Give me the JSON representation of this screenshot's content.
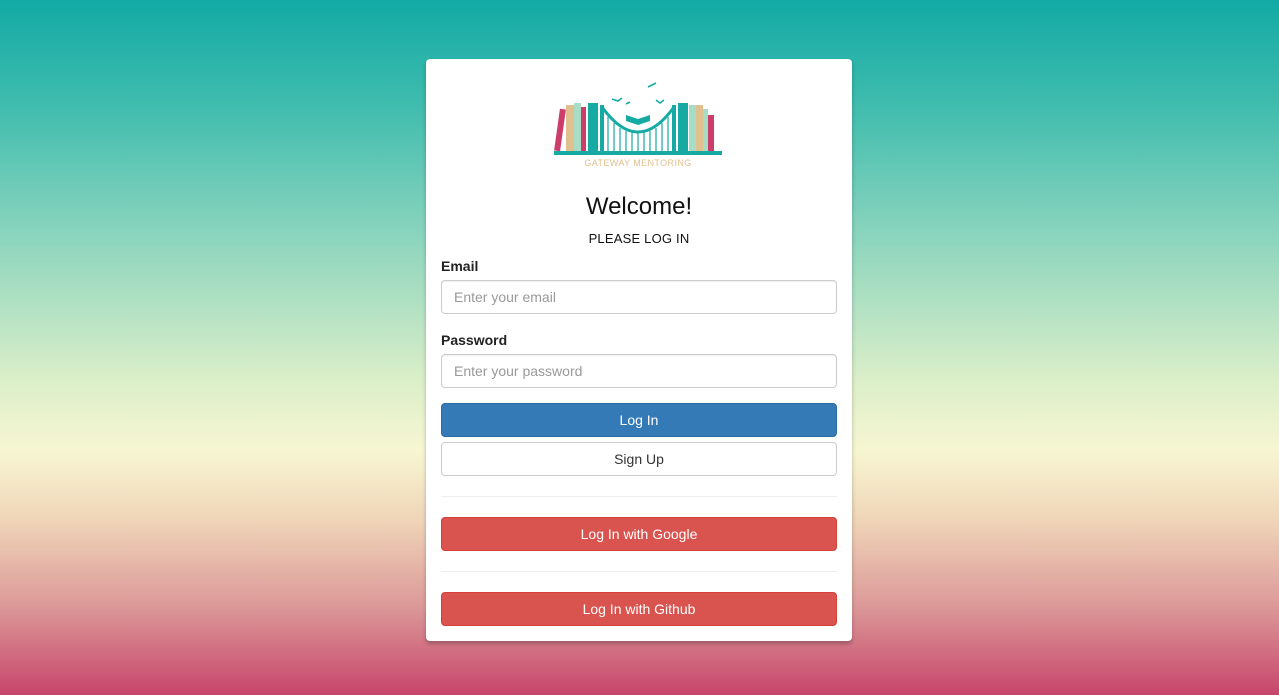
{
  "logo": {
    "text": "GATEWAY MENTORING",
    "icon": "bookshelf-bridge-logo"
  },
  "heading": "Welcome!",
  "subtitle": "PLEASE LOG IN",
  "email": {
    "label": "Email",
    "placeholder": "Enter your email",
    "value": ""
  },
  "password": {
    "label": "Password",
    "placeholder": "Enter your password",
    "value": ""
  },
  "buttons": {
    "login": "Log In",
    "signup": "Sign Up",
    "google": "Log In with Google",
    "github": "Log In with Github"
  },
  "colors": {
    "primary": "#337ab7",
    "danger": "#d9534f",
    "brand_teal": "#16aaa3",
    "brand_pink": "#cc3d6a",
    "brand_tan": "#e0c08e"
  }
}
